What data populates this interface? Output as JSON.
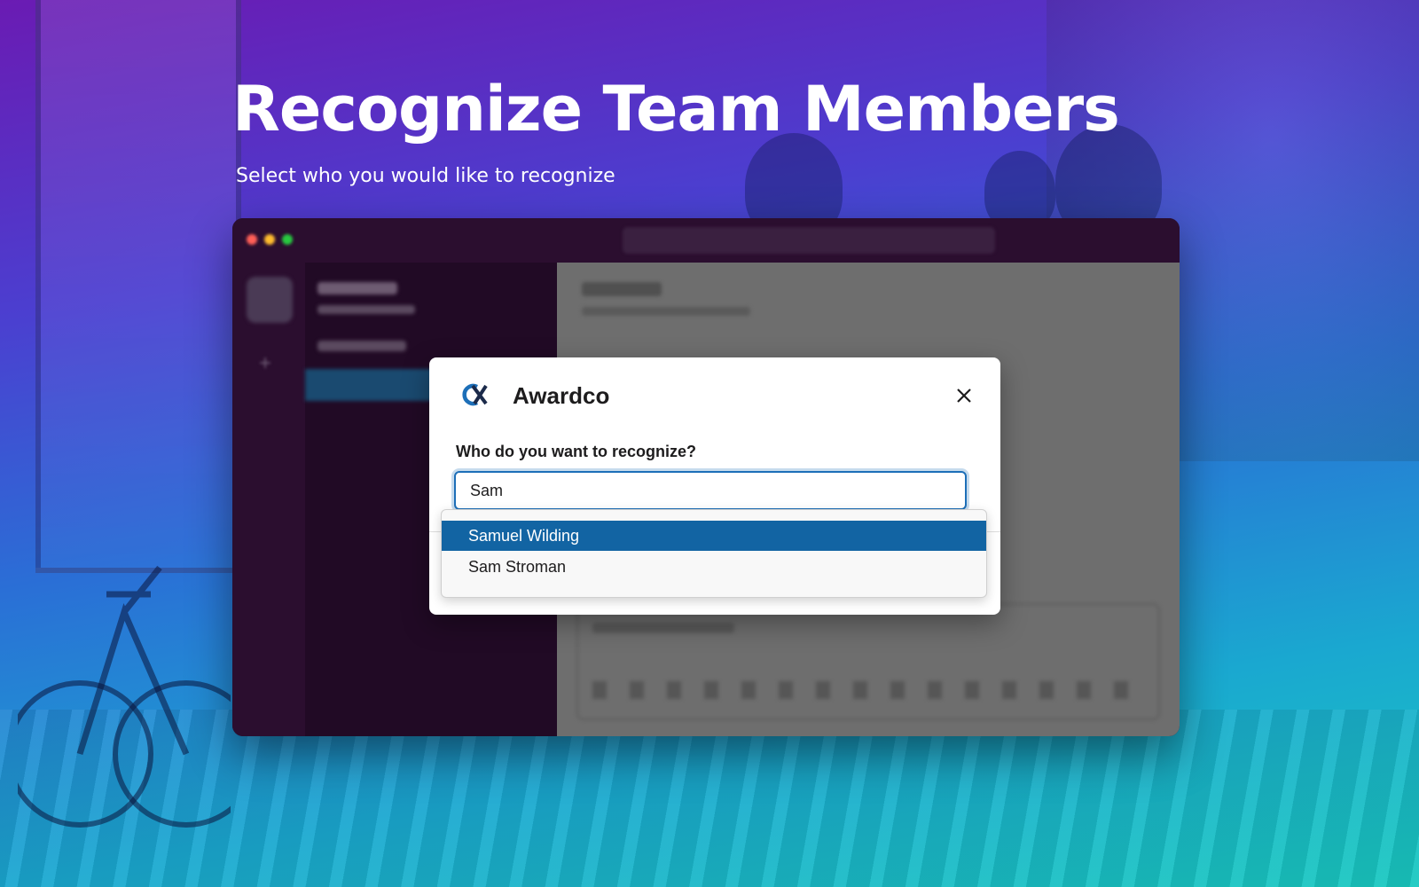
{
  "hero": {
    "title": "Recognize Team Members",
    "subtitle": "Select who you would like to recognize"
  },
  "modal": {
    "app_name": "Awardco",
    "logo_icon": "awardco-logo-icon",
    "close_icon": "close-icon",
    "field_label": "Who do you want to recognize?",
    "input_value": "Sam",
    "options": [
      {
        "label": "Samuel Wilding",
        "selected": true
      },
      {
        "label": "Sam Stroman",
        "selected": false
      }
    ]
  },
  "colors": {
    "accent": "#1264a3",
    "input_focus": "#1d6fb8",
    "logo_blue": "#1d6fb8",
    "logo_dark": "#1b2a4a"
  }
}
